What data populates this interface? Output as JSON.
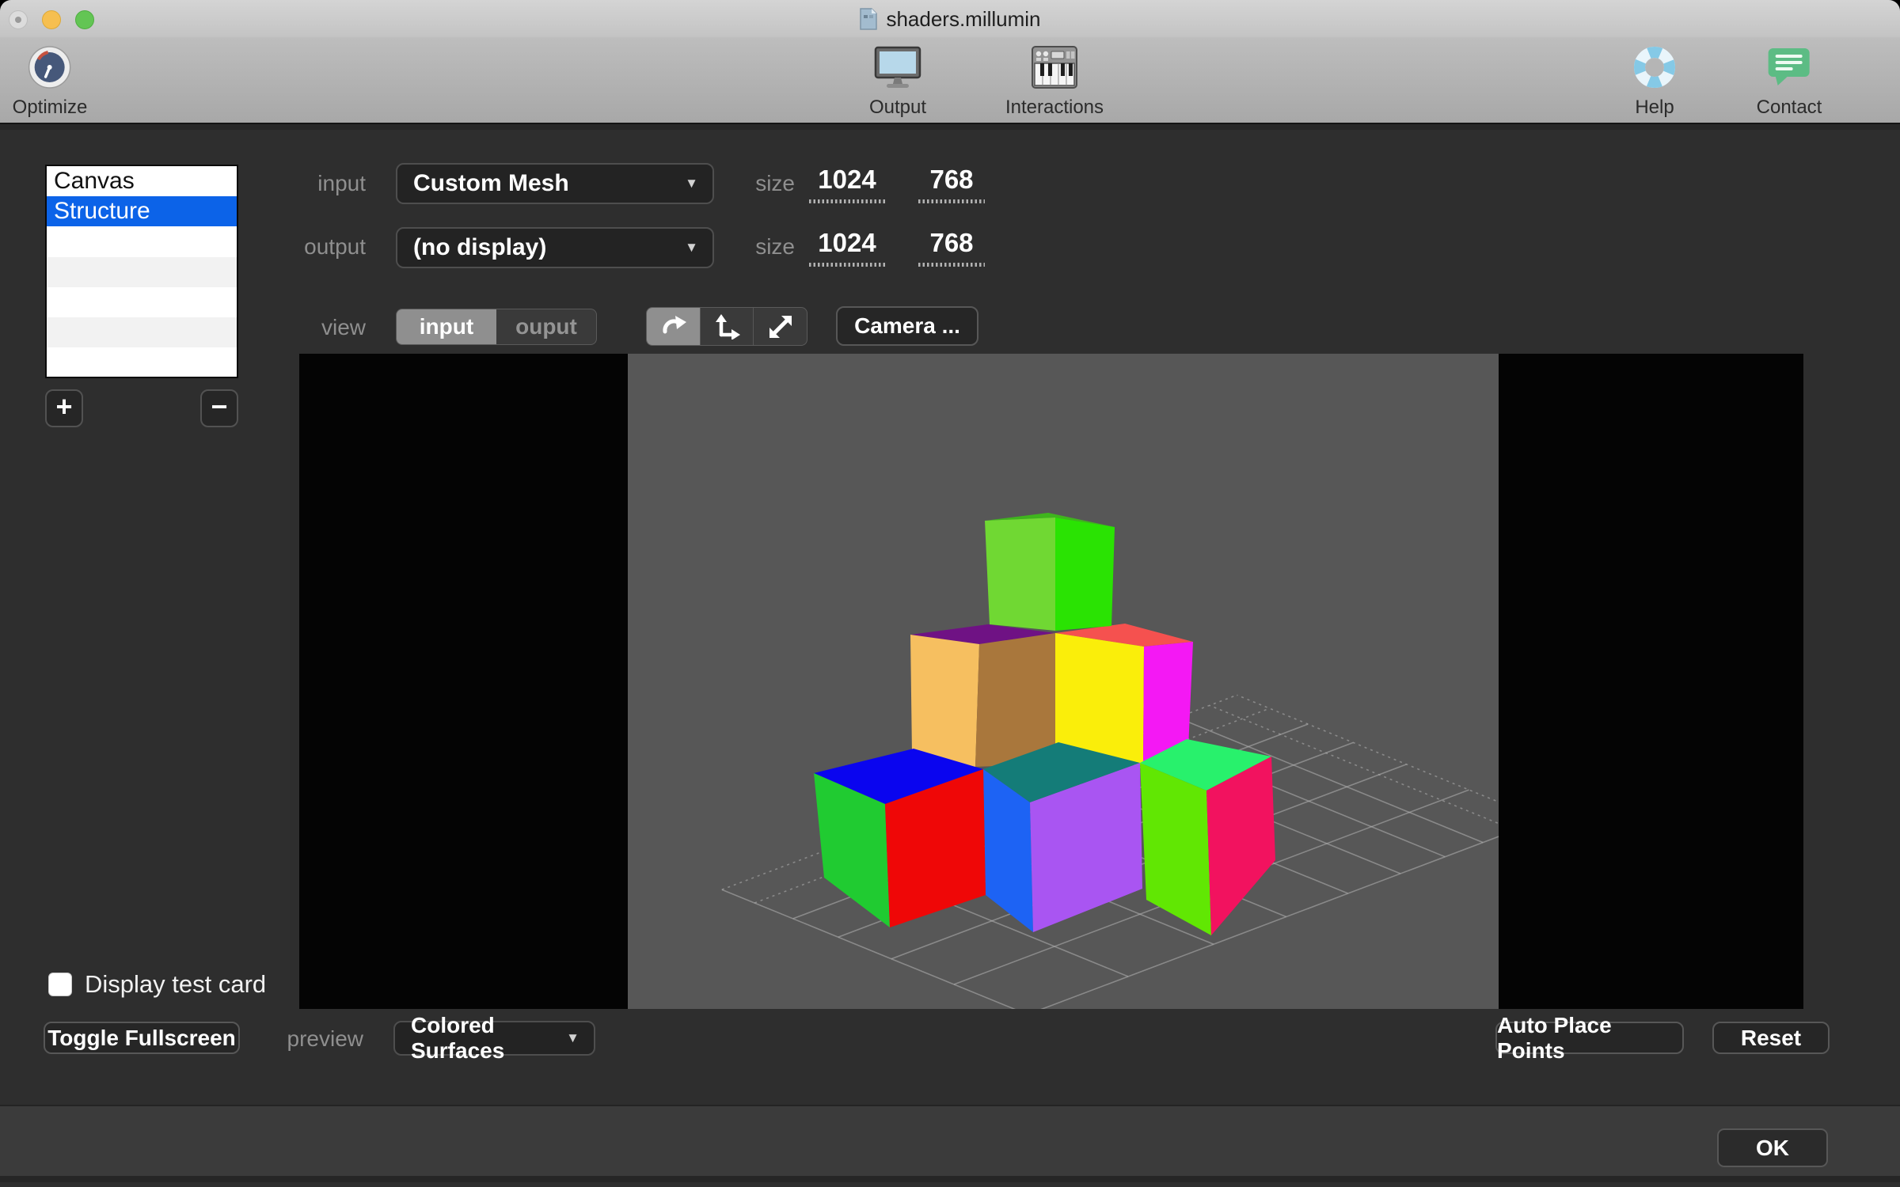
{
  "window": {
    "title": "shaders.millumin",
    "traffic_lights": {
      "close": "#dcdcdc",
      "minimize": "#f6bf50",
      "zoom": "#63c554"
    }
  },
  "toolbar": {
    "items": [
      {
        "id": "optimize",
        "label": "Optimize"
      },
      {
        "id": "output",
        "label": "Output"
      },
      {
        "id": "interactions",
        "label": "Interactions"
      },
      {
        "id": "help",
        "label": "Help"
      },
      {
        "id": "contact",
        "label": "Contact"
      }
    ]
  },
  "layers": {
    "items": [
      {
        "label": "Canvas",
        "selected": false
      },
      {
        "label": "Structure",
        "selected": true
      }
    ],
    "selection_color": "#0c63e8",
    "add_label": "+",
    "remove_label": "−"
  },
  "form": {
    "input": {
      "label": "input",
      "value": "Custom Mesh"
    },
    "output": {
      "label": "output",
      "value": "(no display)"
    },
    "input_size": {
      "label": "size",
      "width": "1024",
      "height": "768"
    },
    "output_size": {
      "label": "size",
      "width": "1024",
      "height": "768"
    },
    "view": {
      "label": "view",
      "options": [
        "input",
        "ouput"
      ],
      "selected": "input"
    },
    "camera_button": "Camera ..."
  },
  "viewport": {
    "background": "#575757",
    "grid_color": "#b3b3b3",
    "cubes": {
      "top": {
        "top": "#3fb51d",
        "left": "#70d833",
        "right": "#2ae303"
      },
      "middle_left": {
        "top": "#6f1284",
        "left": "#f6bf60",
        "right": "#a9773c"
      },
      "middle_right": {
        "top": "#f5514f",
        "left": "#faee0a",
        "right": "#f418f4"
      },
      "bottom_left": {
        "top": "#0a05ef",
        "left": "#20cb31",
        "right": "#ef0707"
      },
      "bottom_middle": {
        "top": "#147c78",
        "left": "#1d63f4",
        "right": "#a955f2"
      },
      "bottom_right": {
        "top": "#28f16c",
        "left": "#61e703",
        "right": "#f2125f"
      }
    }
  },
  "bottom": {
    "display_test_card": "Display test card",
    "toggle_fullscreen": "Toggle Fullscreen",
    "preview_label": "preview",
    "preview_mode": "Colored Surfaces",
    "auto_place_points": "Auto Place Points",
    "reset": "Reset"
  },
  "footer": {
    "ok": "OK"
  }
}
